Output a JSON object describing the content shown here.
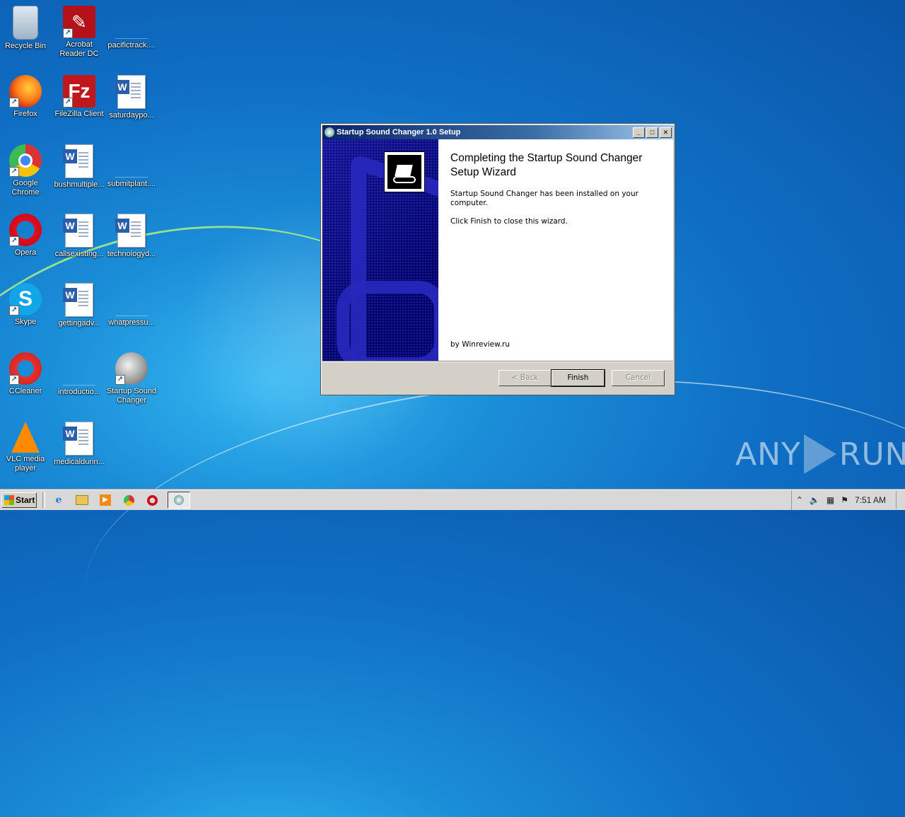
{
  "desktop": {
    "icons": [
      {
        "label": "Recycle Bin",
        "icon": "recycle-bin-icon"
      },
      {
        "label": "Acrobat Reader DC",
        "icon": "acrobat-icon"
      },
      {
        "label": "pacifictrack....",
        "icon": "blank-file-icon"
      },
      {
        "label": "Firefox",
        "icon": "firefox-icon"
      },
      {
        "label": "FileZilla Client",
        "icon": "filezilla-icon"
      },
      {
        "label": "saturdaypo...",
        "icon": "word-doc-icon"
      },
      {
        "label": "Google Chrome",
        "icon": "chrome-icon"
      },
      {
        "label": "bushmultiple...",
        "icon": "word-doc-icon"
      },
      {
        "label": "submitplant....",
        "icon": "blank-file-icon"
      },
      {
        "label": "Opera",
        "icon": "opera-icon"
      },
      {
        "label": "callsexisting...",
        "icon": "word-doc-icon"
      },
      {
        "label": "technologyd...",
        "icon": "word-doc-icon"
      },
      {
        "label": "Skype",
        "icon": "skype-icon"
      },
      {
        "label": "gettingadv...",
        "icon": "word-doc-icon"
      },
      {
        "label": "whatpressu...",
        "icon": "blank-file-icon"
      },
      {
        "label": "CCleaner",
        "icon": "ccleaner-icon"
      },
      {
        "label": "introductio...",
        "icon": "blank-file-icon"
      },
      {
        "label": "Startup Sound Changer",
        "icon": "speaker-icon"
      },
      {
        "label": "VLC media player",
        "icon": "vlc-icon"
      },
      {
        "label": "medicaldurin...",
        "icon": "word-doc-icon"
      }
    ]
  },
  "window": {
    "title": "Startup Sound Changer 1.0 Setup",
    "controls": {
      "minimize": "_",
      "maximize": "□",
      "close": "✕"
    },
    "heading": "Completing the Startup Sound Changer Setup Wizard",
    "body1": "Startup Sound Changer has been installed on your computer.",
    "body2": "Click Finish to close this wizard.",
    "footer": "by Winreview.ru",
    "buttons": {
      "back": "< Back",
      "finish": "Finish",
      "cancel": "Cancel"
    }
  },
  "taskbar": {
    "start_label": "Start",
    "quick_launch": [
      "internet-explorer-icon",
      "folder-icon",
      "media-player-icon",
      "chrome-icon",
      "opera-icon"
    ],
    "clock": "7:51 AM"
  },
  "watermark": {
    "left": "ANY",
    "right": "RUN"
  }
}
